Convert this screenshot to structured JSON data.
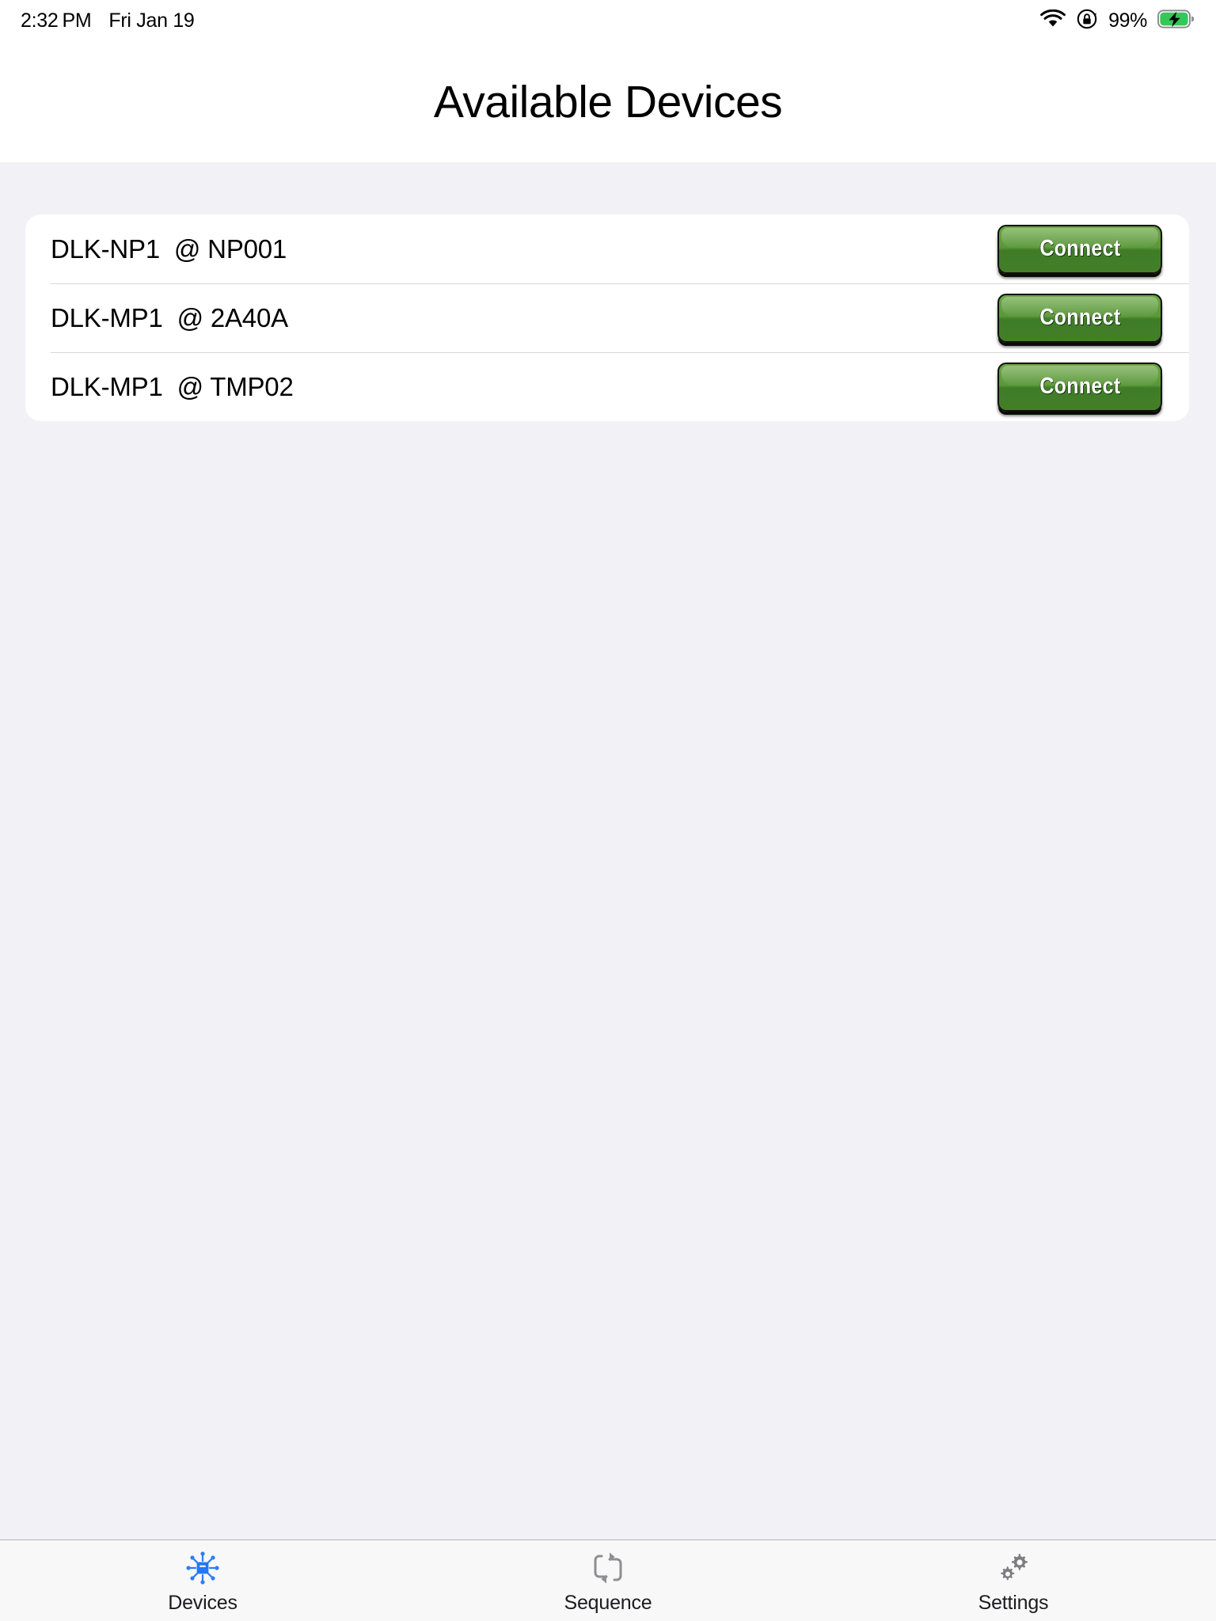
{
  "status_bar": {
    "time": "2:32",
    "ampm": "PM",
    "date": "Fri Jan 19",
    "battery_percent": "99%",
    "wifi_icon": "wifi-icon",
    "rotation_lock_icon": "rotation-lock-icon",
    "battery_icon": "battery-charging-icon"
  },
  "header": {
    "title": "Available Devices"
  },
  "devices": [
    {
      "name": "DLK-NP1  @ NP001",
      "action_label": "Connect"
    },
    {
      "name": "DLK-MP1  @ 2A40A",
      "action_label": "Connect"
    },
    {
      "name": "DLK-MP1  @ TMP02",
      "action_label": "Connect"
    }
  ],
  "tabs": [
    {
      "label": "Devices",
      "icon": "devices-hub-icon",
      "active": true
    },
    {
      "label": "Sequence",
      "icon": "repeat-loop-icon",
      "active": false
    },
    {
      "label": "Settings",
      "icon": "gears-icon",
      "active": false
    }
  ],
  "colors": {
    "accent_blue": "#2e7ef7",
    "connect_green": "#599738",
    "background": "#f2f1f6",
    "card": "#ffffff",
    "battery_green": "#34c759",
    "tab_inactive": "#8e8e93"
  }
}
